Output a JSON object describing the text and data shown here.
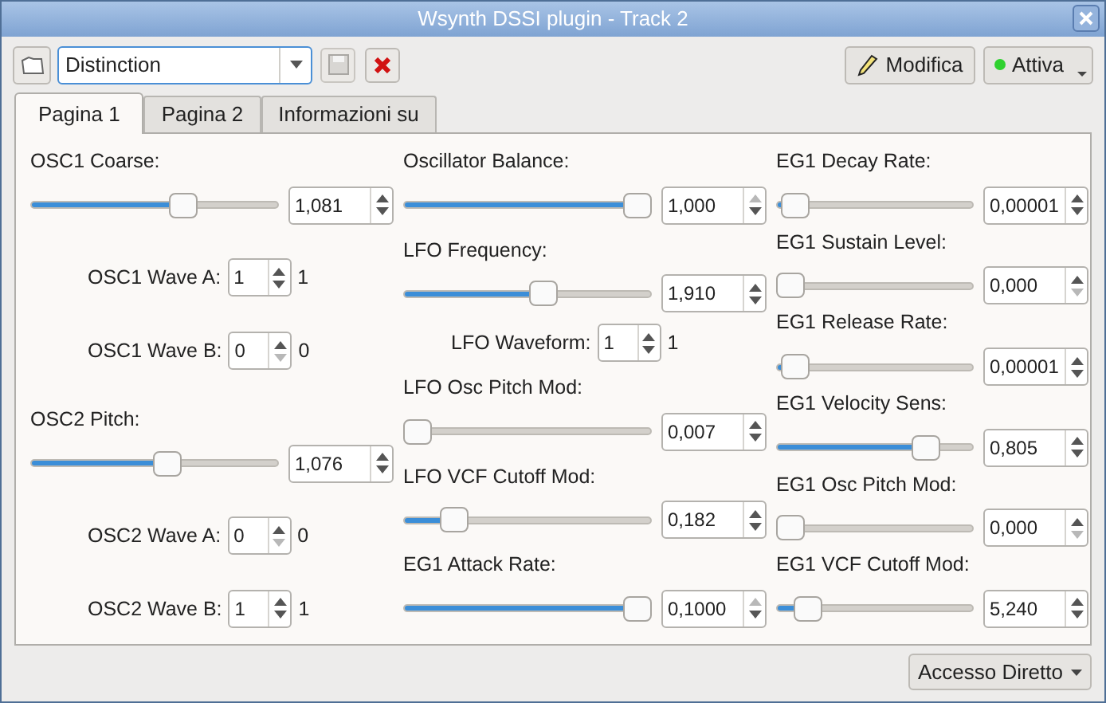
{
  "window": {
    "title": "Wsynth DSSI plugin - Track 2"
  },
  "toolbar": {
    "preset": {
      "value": "Distinction"
    },
    "save_disabled": true,
    "edit_button": {
      "label": "Modifica"
    },
    "active_button": {
      "label": "Attiva",
      "on": true
    }
  },
  "tabs": [
    {
      "label": "Pagina 1",
      "selected": true
    },
    {
      "label": "Pagina 2",
      "selected": false
    },
    {
      "label": "Informazioni su",
      "selected": false
    }
  ],
  "columns": [
    {
      "controls": [
        {
          "kind": "slider",
          "label": "OSC1 Coarse:",
          "level": 0.63,
          "value": "1,081",
          "up_disabled": false,
          "down_disabled": false
        },
        {
          "kind": "spin",
          "label": "OSC1 Wave A:",
          "value": "1",
          "readout": "1",
          "up_disabled": false,
          "down_disabled": false
        },
        {
          "kind": "spin",
          "label": "OSC1 Wave B:",
          "value": "0",
          "readout": "0",
          "up_disabled": false,
          "down_disabled": true
        },
        {
          "kind": "slider",
          "label": "OSC2 Pitch:",
          "level": 0.56,
          "value": "1,076",
          "up_disabled": false,
          "down_disabled": false
        },
        {
          "kind": "spin",
          "label": "OSC2 Wave A:",
          "value": "0",
          "readout": "0",
          "up_disabled": false,
          "down_disabled": true
        },
        {
          "kind": "spin",
          "label": "OSC2 Wave B:",
          "value": "1",
          "readout": "1",
          "up_disabled": false,
          "down_disabled": false
        }
      ]
    },
    {
      "controls": [
        {
          "kind": "slider",
          "label": "Oscillator Balance:",
          "level": 1.0,
          "value": "1,000",
          "up_disabled": true,
          "down_disabled": false
        },
        {
          "kind": "slider",
          "label": "LFO Frequency:",
          "level": 0.57,
          "value": "1,910",
          "up_disabled": false,
          "down_disabled": false
        },
        {
          "kind": "spin",
          "label": "LFO Waveform:",
          "value": "1",
          "readout": "1",
          "up_disabled": false,
          "down_disabled": false
        },
        {
          "kind": "slider",
          "label": "LFO Osc Pitch Mod:",
          "level": 0.0,
          "value": "0,007",
          "up_disabled": false,
          "down_disabled": false
        },
        {
          "kind": "slider",
          "label": "LFO VCF Cutoff Mod:",
          "level": 0.17,
          "value": "0,182",
          "up_disabled": false,
          "down_disabled": false
        },
        {
          "kind": "slider",
          "label": "EG1 Attack Rate:",
          "level": 1.0,
          "value": "0,1000",
          "up_disabled": true,
          "down_disabled": false
        }
      ]
    },
    {
      "controls": [
        {
          "kind": "slider",
          "label": "EG1 Decay Rate:",
          "level": 0.03,
          "value": "0,00001",
          "up_disabled": false,
          "down_disabled": false
        },
        {
          "kind": "slider",
          "label": "EG1 Sustain Level:",
          "level": 0.0,
          "value": "0,000",
          "up_disabled": false,
          "down_disabled": true
        },
        {
          "kind": "slider",
          "label": "EG1 Release Rate:",
          "level": 0.03,
          "value": "0,00001",
          "up_disabled": false,
          "down_disabled": false
        },
        {
          "kind": "slider",
          "label": "EG1 Velocity Sens:",
          "level": 0.8,
          "value": "0,805",
          "up_disabled": false,
          "down_disabled": false
        },
        {
          "kind": "slider",
          "label": "EG1 Osc Pitch Mod:",
          "level": 0.0,
          "value": "0,000",
          "up_disabled": false,
          "down_disabled": true
        },
        {
          "kind": "slider",
          "label": "EG1 VCF Cutoff Mod:",
          "level": 0.1,
          "value": "5,240",
          "up_disabled": false,
          "down_disabled": false
        }
      ]
    }
  ],
  "footer_button": {
    "label": "Accesso Diretto"
  }
}
